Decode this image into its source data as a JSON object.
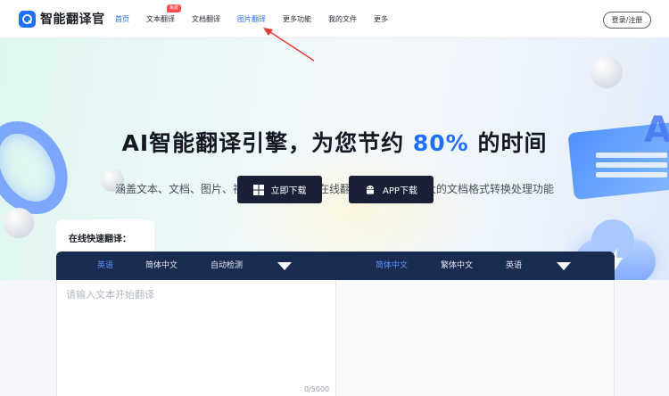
{
  "header": {
    "brand": "智能翻译官",
    "nav": [
      {
        "label": "首页",
        "active": true
      },
      {
        "label": "文本翻译",
        "badge": "免费"
      },
      {
        "label": "文档翻译"
      },
      {
        "label": "图片翻译",
        "active": true
      },
      {
        "label": "更多功能"
      },
      {
        "label": "我的文件"
      },
      {
        "label": "更多"
      }
    ],
    "login_label": "登录/注册"
  },
  "hero": {
    "headline_pre": "AI智能翻译引擎，为您节约 ",
    "headline_highlight": "80%",
    "headline_post": " 的时间",
    "subline": "涵盖文本、文档、图片、视频、音频等多种在线翻译模式，更有强大的文档格式转换处理功能",
    "download_label": "立即下载",
    "app_label": "APP下载",
    "decor_text": "A",
    "card_lines": [
      "",
      ""
    ]
  },
  "translator": {
    "title": "在线快速翻译：",
    "source_langs": [
      "英语",
      "简体中文",
      "自动检测"
    ],
    "target_langs": [
      "简体中文",
      "繁体中文",
      "英语"
    ],
    "placeholder": "请输入文本开始翻译",
    "counter": "0/5000"
  },
  "colors": {
    "accent": "#1f6fff",
    "dark_button": "#1a2035",
    "lang_bar": "#1a2b52",
    "badge": "#ff4d4f",
    "annotation_arrow": "#e53935"
  }
}
